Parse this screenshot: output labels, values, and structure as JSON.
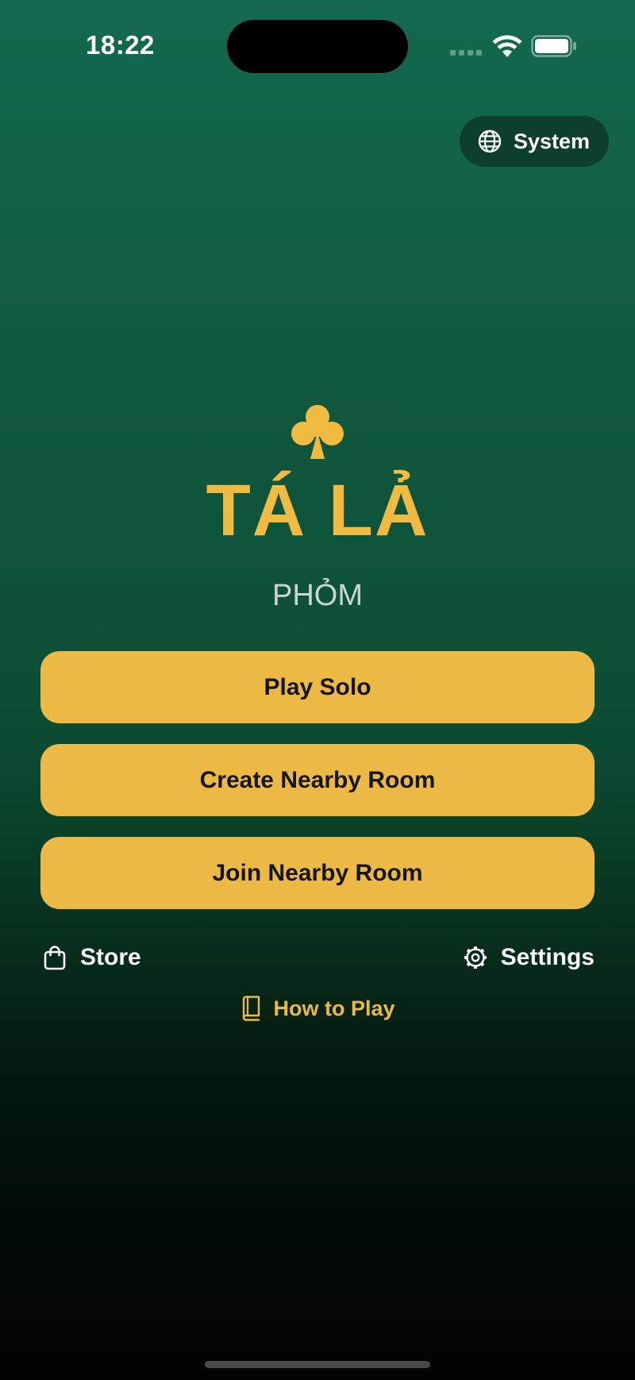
{
  "status_bar": {
    "time": "18:22"
  },
  "language_button": {
    "label": "System",
    "icon": "globe-icon"
  },
  "logo": {
    "icon": "club-suit-icon",
    "title": "TÁ LẢ",
    "subtitle": "PHỎM"
  },
  "menu": {
    "play_solo": "Play Solo",
    "create_room": "Create Nearby Room",
    "join_room": "Join Nearby Room"
  },
  "footer_links": {
    "store": "Store",
    "settings": "Settings",
    "how_to_play": "How to Play"
  },
  "colors": {
    "accent": "#ecb944",
    "background_top": "#136a4e",
    "background_bottom": "#010302"
  }
}
